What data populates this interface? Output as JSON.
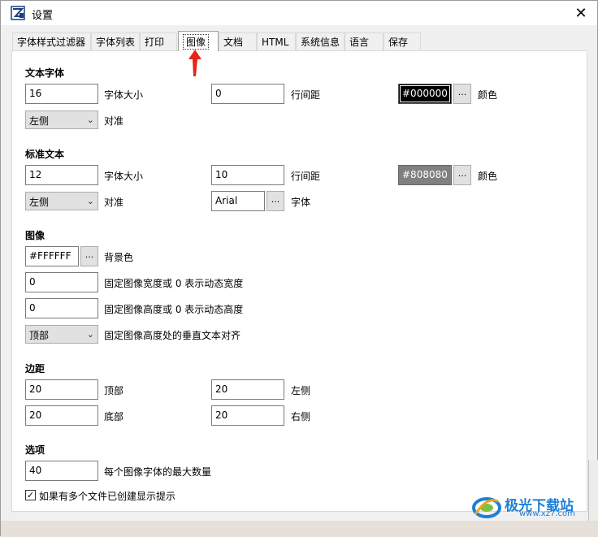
{
  "window": {
    "title": "设置",
    "close_glyph": "✕"
  },
  "tabs": [
    {
      "label": "字体样式过滤器",
      "active": false
    },
    {
      "label": "字体列表",
      "active": false
    },
    {
      "label": "打印",
      "active": false
    },
    {
      "label": "图像",
      "active": true
    },
    {
      "label": "文档",
      "active": false
    },
    {
      "label": "HTML",
      "active": false
    },
    {
      "label": "系统信息",
      "active": false
    },
    {
      "label": "语言",
      "active": false
    },
    {
      "label": "保存",
      "active": false
    }
  ],
  "text_font": {
    "heading": "文本字体",
    "font_size_value": "16",
    "font_size_label": "字体大小",
    "line_spacing_value": "0",
    "line_spacing_label": "行间距",
    "color_value": "#000000",
    "color_label": "颜色",
    "align_value": "左侧",
    "align_label": "对准",
    "browse_label": "..."
  },
  "standard_text": {
    "heading": "标准文本",
    "font_size_value": "12",
    "font_size_label": "字体大小",
    "line_spacing_value": "10",
    "line_spacing_label": "行间距",
    "color_value": "#808080",
    "color_label": "颜色",
    "align_value": "左侧",
    "align_label": "对准",
    "font_value": "Arial",
    "font_label": "字体",
    "browse_label": "..."
  },
  "image": {
    "heading": "图像",
    "bg_value": "#FFFFFF",
    "bg_label": "背景色",
    "width_value": "0",
    "width_label": "固定图像宽度或 0 表示动态宽度",
    "height_value": "0",
    "height_label": "固定图像高度或 0 表示动态高度",
    "valign_value": "顶部",
    "valign_label": "固定图像高度处的垂直文本对齐",
    "browse_label": "..."
  },
  "margins": {
    "heading": "边距",
    "top_value": "20",
    "top_label": "顶部",
    "left_value": "20",
    "left_label": "左侧",
    "bottom_value": "20",
    "bottom_label": "底部",
    "right_value": "20",
    "right_label": "右侧"
  },
  "options": {
    "heading": "选项",
    "max_fonts_value": "40",
    "max_fonts_label": "每个图像字体的最大数量",
    "show_hint_checked": true,
    "show_hint_label": "如果有多个文件已创建显示提示"
  },
  "watermark": {
    "name": "极光下载站",
    "url": "www.xz7.com"
  },
  "colors": {
    "accent_arrow": "#e8231a",
    "watermark": "#1e7fd6"
  },
  "icons": {
    "check": "✓",
    "dropdown": "⌄"
  }
}
